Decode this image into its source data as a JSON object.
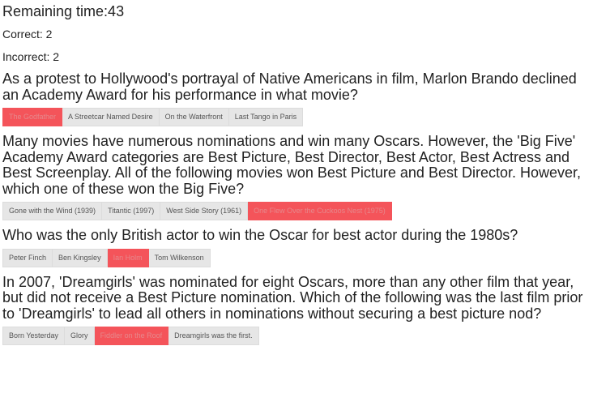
{
  "timer": {
    "label": "Remaining time:43"
  },
  "stats": {
    "correct": "Correct: 2",
    "incorrect": "Incorrect: 2"
  },
  "colors": {
    "wrong_answer": "#f4545a",
    "answer_bg": "#e6e6e6"
  },
  "questions": [
    {
      "text": "As a protest to Hollywood's portrayal of Native Americans in film, Marlon Brando declined an Academy Award for his performance in what movie?",
      "answers": [
        "The Godfather",
        "A Streetcar Named Desire",
        "On the Waterfront",
        "Last Tango in Paris"
      ],
      "wrong_index": 0
    },
    {
      "text": "Many movies have numerous nominations and win many Oscars. However, the 'Big Five' Academy Award categories are Best Picture, Best Director, Best Actor, Best Actress and Best Screenplay. All of the following movies won Best Picture and Best Director. However, which one of these won the Big Five?",
      "answers": [
        "Gone with the Wind (1939)",
        "Titantic (1997)",
        "West Side Story (1961)",
        "One Flew Over the Cuckoos Nest (1975)"
      ],
      "wrong_index": 3
    },
    {
      "text": "Who was the only British actor to win the Oscar for best actor during the 1980s?",
      "answers": [
        "Peter Finch",
        "Ben Kingsley",
        "Ian Holm",
        "Tom Wilkenson"
      ],
      "wrong_index": 2
    },
    {
      "text": "In 2007, 'Dreamgirls' was nominated for eight Oscars, more than any other film that year, but did not receive a Best Picture nomination. Which of the following was the last film prior to 'Dreamgirls' to lead all others in nominations without securing a best picture nod?",
      "answers": [
        "Born Yesterday",
        "Glory",
        "Fiddler on the Roof",
        "Dreamgirls was the first."
      ],
      "wrong_index": 2
    }
  ]
}
